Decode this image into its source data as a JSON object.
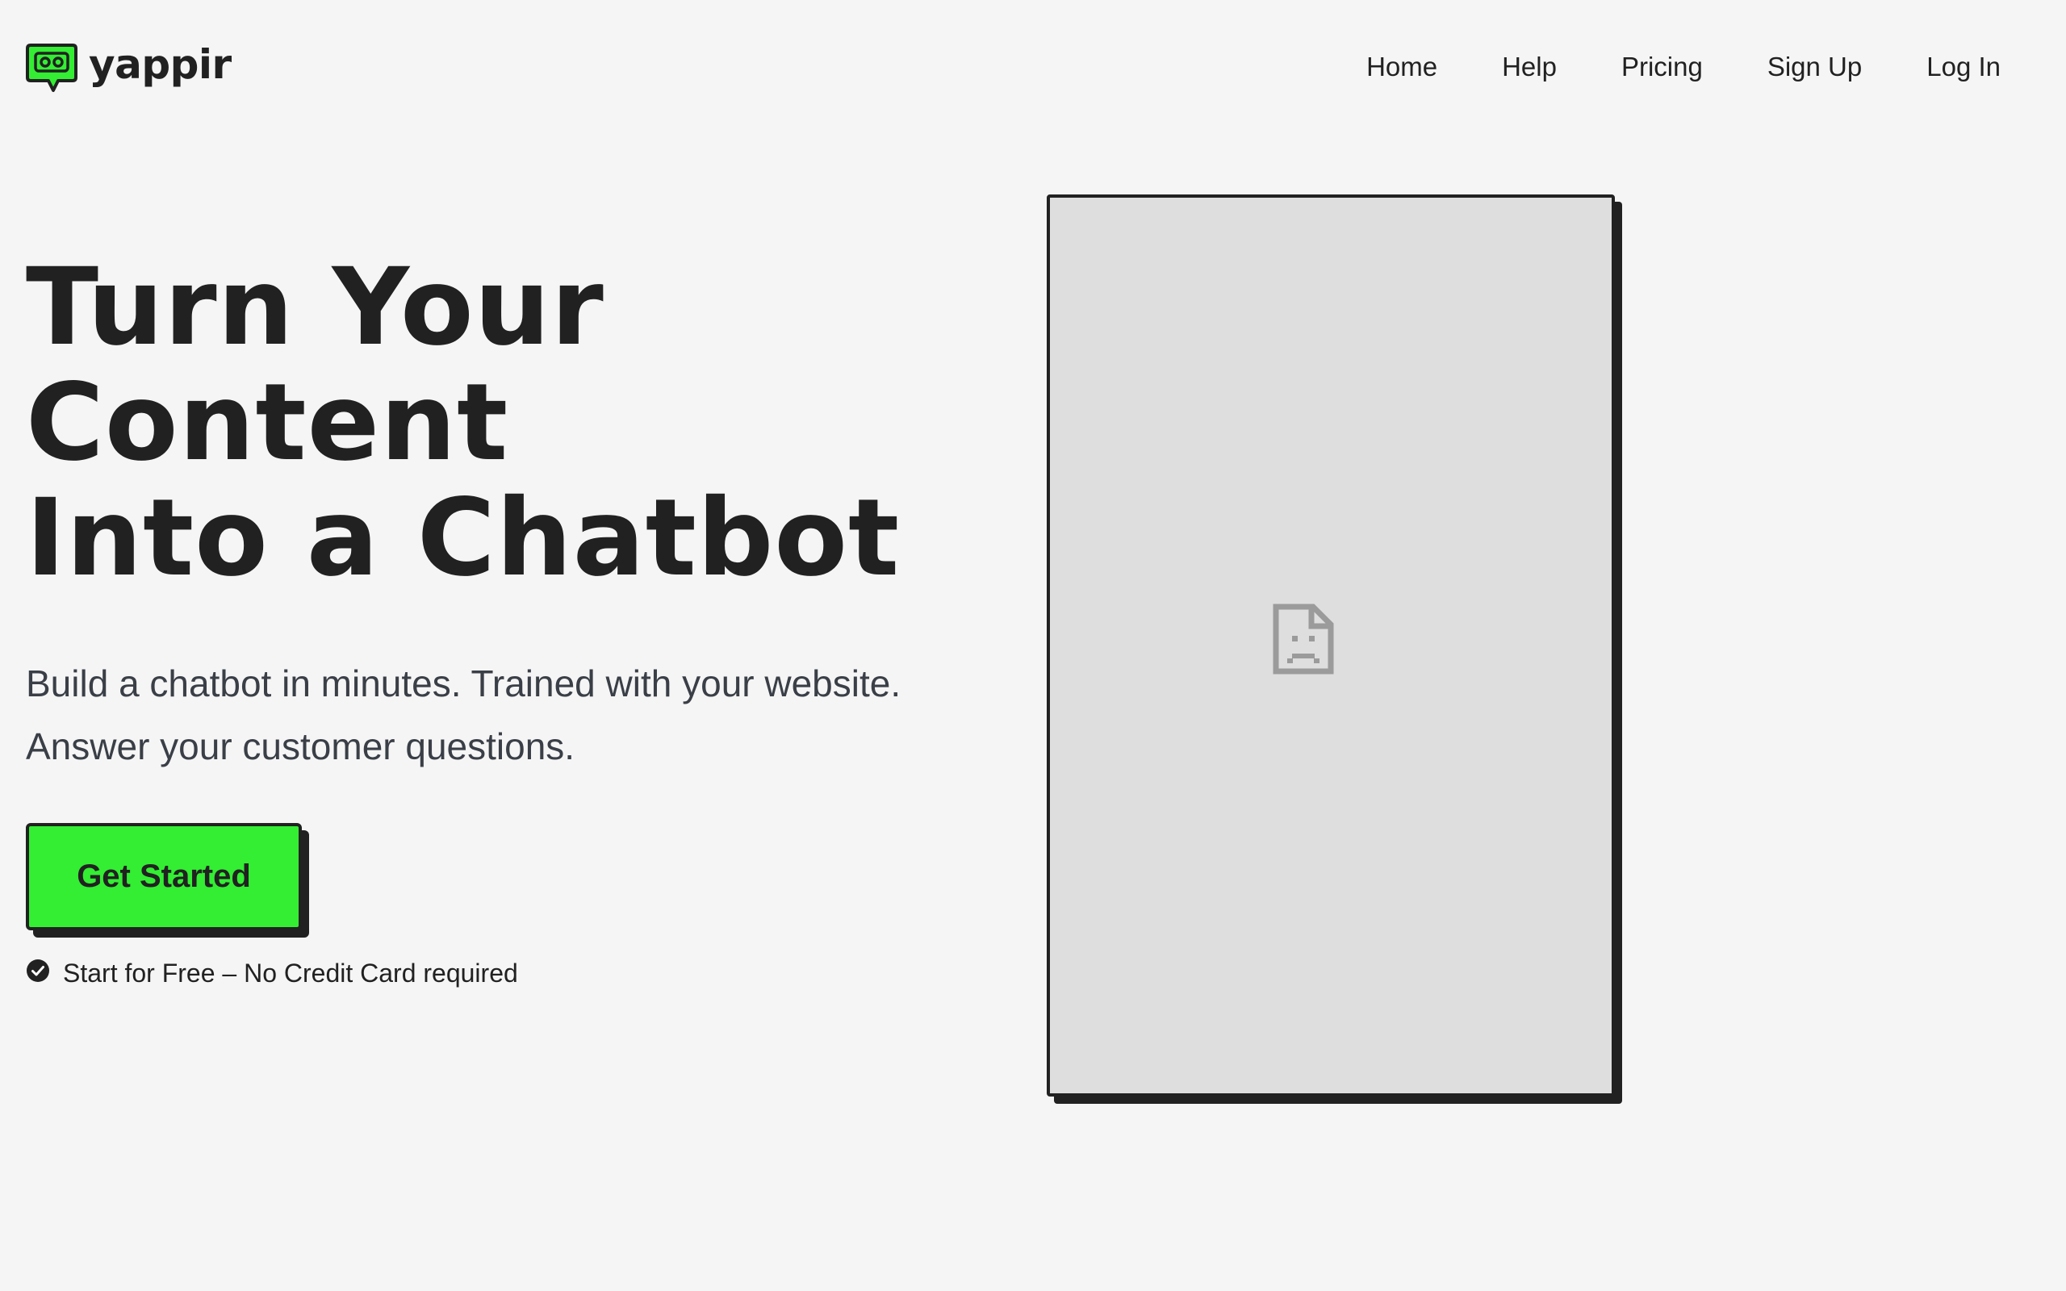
{
  "brand": {
    "name": "yappir",
    "logo_icon": "chat-bubble-robot-icon",
    "colors": {
      "accent": "#33ee33",
      "ink": "#212121",
      "background": "#f5f5f5"
    }
  },
  "nav": {
    "items": [
      {
        "label": "Home"
      },
      {
        "label": "Help"
      },
      {
        "label": "Pricing"
      },
      {
        "label": "Sign Up"
      },
      {
        "label": "Log In"
      }
    ]
  },
  "hero": {
    "title_lines": [
      "Turn Your",
      "Content",
      "Into a Chatbot"
    ],
    "subtitle_lines": [
      "Build a chatbot in minutes. Trained with your website.",
      "Answer your customer questions."
    ],
    "cta_label": "Get Started",
    "note": "Start for Free – No Credit Card required",
    "note_icon": "check-circle-icon"
  },
  "media": {
    "icon": "broken-image-icon"
  }
}
